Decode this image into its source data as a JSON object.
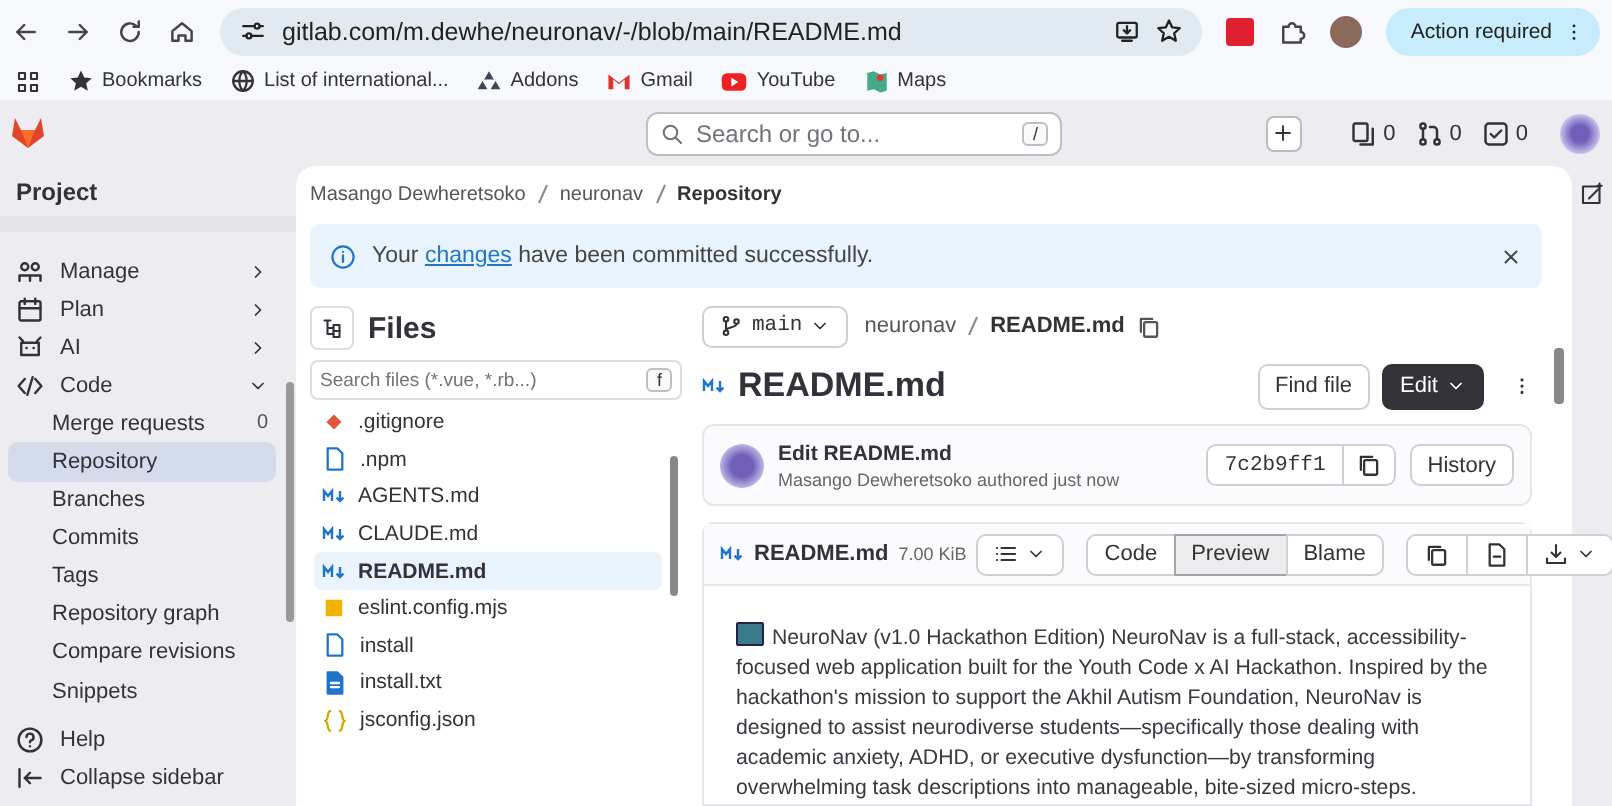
{
  "browser": {
    "url": "gitlab.com/m.dewhe/neuronav/-/blob/main/README.md",
    "action_button": "Action required",
    "bookmarks": [
      {
        "label": "Bookmarks",
        "kind": "star"
      },
      {
        "label": "List of international...",
        "kind": "wiki"
      },
      {
        "label": "Addons",
        "kind": "addons"
      },
      {
        "label": "Gmail",
        "kind": "mail"
      },
      {
        "label": "YouTube",
        "kind": "video"
      },
      {
        "label": "Maps",
        "kind": "map"
      }
    ]
  },
  "topbar": {
    "search": {
      "placeholder": "Search or go to...",
      "shortcut": "/"
    },
    "counters": [
      {
        "kind": "issues",
        "count": "0"
      },
      {
        "kind": "merge_requests",
        "count": "0"
      },
      {
        "kind": "todos",
        "count": "0"
      }
    ]
  },
  "sidebar": {
    "title": "Project",
    "items": [
      {
        "label": "Manage",
        "kind": "manage",
        "expanded": false
      },
      {
        "label": "Plan",
        "kind": "plan",
        "expanded": false
      },
      {
        "label": "AI",
        "kind": "ai",
        "expanded": false
      },
      {
        "label": "Code",
        "kind": "code",
        "expanded": true,
        "children": [
          {
            "label": "Merge requests",
            "selected": false,
            "count": "0"
          },
          {
            "label": "Repository",
            "selected": true
          },
          {
            "label": "Branches",
            "selected": false
          },
          {
            "label": "Commits",
            "selected": false
          },
          {
            "label": "Tags",
            "selected": false
          },
          {
            "label": "Repository graph",
            "selected": false
          },
          {
            "label": "Compare revisions",
            "selected": false
          },
          {
            "label": "Snippets",
            "selected": false
          }
        ]
      }
    ],
    "footer": [
      {
        "label": "Help",
        "kind": "help"
      },
      {
        "label": "Collapse sidebar",
        "kind": "collapse"
      }
    ]
  },
  "breadcrumb": [
    "Masango Dewheretsoko",
    "neuronav",
    "Repository"
  ],
  "alert": {
    "before": "Your ",
    "link": "changes",
    "after": " have been committed successfully."
  },
  "files": {
    "title": "Files",
    "search": {
      "placeholder": "Search files (*.vue, *.rb...)",
      "shortcut": "f"
    },
    "items": [
      {
        "name": ".gitignore",
        "kind": "git",
        "selected": false
      },
      {
        "name": ".npm",
        "kind": "file",
        "selected": false
      },
      {
        "name": "AGENTS.md",
        "kind": "markdown",
        "selected": false
      },
      {
        "name": "CLAUDE.md",
        "kind": "markdown",
        "selected": false
      },
      {
        "name": "README.md",
        "kind": "markdown",
        "selected": true
      },
      {
        "name": "eslint.config.mjs",
        "kind": "js",
        "selected": false
      },
      {
        "name": "install",
        "kind": "file",
        "selected": false
      },
      {
        "name": "install.txt",
        "kind": "text",
        "selected": false
      },
      {
        "name": "jsconfig.json",
        "kind": "json",
        "selected": false
      }
    ]
  },
  "blob": {
    "branch": "main",
    "path": [
      "neuronav",
      "README.md"
    ],
    "title": "README.md",
    "find_button": "Find file",
    "edit_button": "Edit",
    "commit": {
      "message": "Edit README.md",
      "byline": "Masango Dewheretsoko authored just now",
      "sha": "7c2b9ff1",
      "history_button": "History"
    },
    "file": {
      "name": "README.md",
      "size": "7.00 KiB",
      "views": [
        {
          "label": "Code",
          "selected": false
        },
        {
          "label": "Preview",
          "selected": true
        },
        {
          "label": "Blame",
          "selected": false
        }
      ],
      "body": "NeuroNav (v1.0 Hackathon Edition) NeuroNav is a full-stack, accessibility-focused web application built for the Youth Code x AI Hackathon. Inspired by the hackathon's mission to support the Akhil Autism Foundation, NeuroNav is designed to assist neurodiverse students—specifically those dealing with academic anxiety, ADHD, or executive dysfunction—by transforming overwhelming task descriptions into manageable, bite-sized micro-steps."
    }
  }
}
